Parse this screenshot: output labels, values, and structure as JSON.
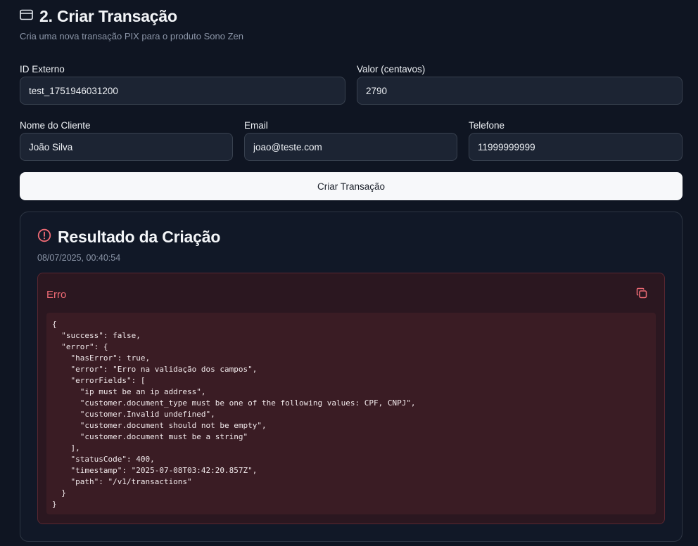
{
  "header": {
    "title": "2. Criar Transação",
    "subtitle": "Cria uma nova transação PIX para o produto Sono Zen",
    "icon": "credit-card-icon"
  },
  "form": {
    "external_id": {
      "label": "ID Externo",
      "value": "test_1751946031200"
    },
    "amount": {
      "label": "Valor (centavos)",
      "value": "2790"
    },
    "customer_name": {
      "label": "Nome do Cliente",
      "value": "João Silva"
    },
    "email": {
      "label": "Email",
      "value": "joao@teste.com"
    },
    "phone": {
      "label": "Telefone",
      "value": "11999999999"
    },
    "submit_label": "Criar Transação"
  },
  "result": {
    "title": "Resultado da Criação",
    "icon": "alert-circle-icon",
    "timestamp": "08/07/2025, 00:40:54",
    "status_label": "Erro",
    "copy_icon": "copy-icon",
    "code": "{\n  \"success\": false,\n  \"error\": {\n    \"hasError\": true,\n    \"error\": \"Erro na validação dos campos\",\n    \"errorFields\": [\n      \"ip must be an ip address\",\n      \"customer.document_type must be one of the following values: CPF, CNPJ\",\n      \"customer.Invalid undefined\",\n      \"customer.document should not be empty\",\n      \"customer.document must be a string\"\n    ],\n    \"statusCode\": 400,\n    \"timestamp\": \"2025-07-08T03:42:20.857Z\",\n    \"path\": \"/v1/transactions\"\n  }\n}"
  },
  "colors": {
    "background": "#0f1522",
    "input_bg": "#1c2433",
    "error_text": "#f06b75",
    "error_bg": "#2b1720",
    "code_bg": "#3a1c24"
  }
}
